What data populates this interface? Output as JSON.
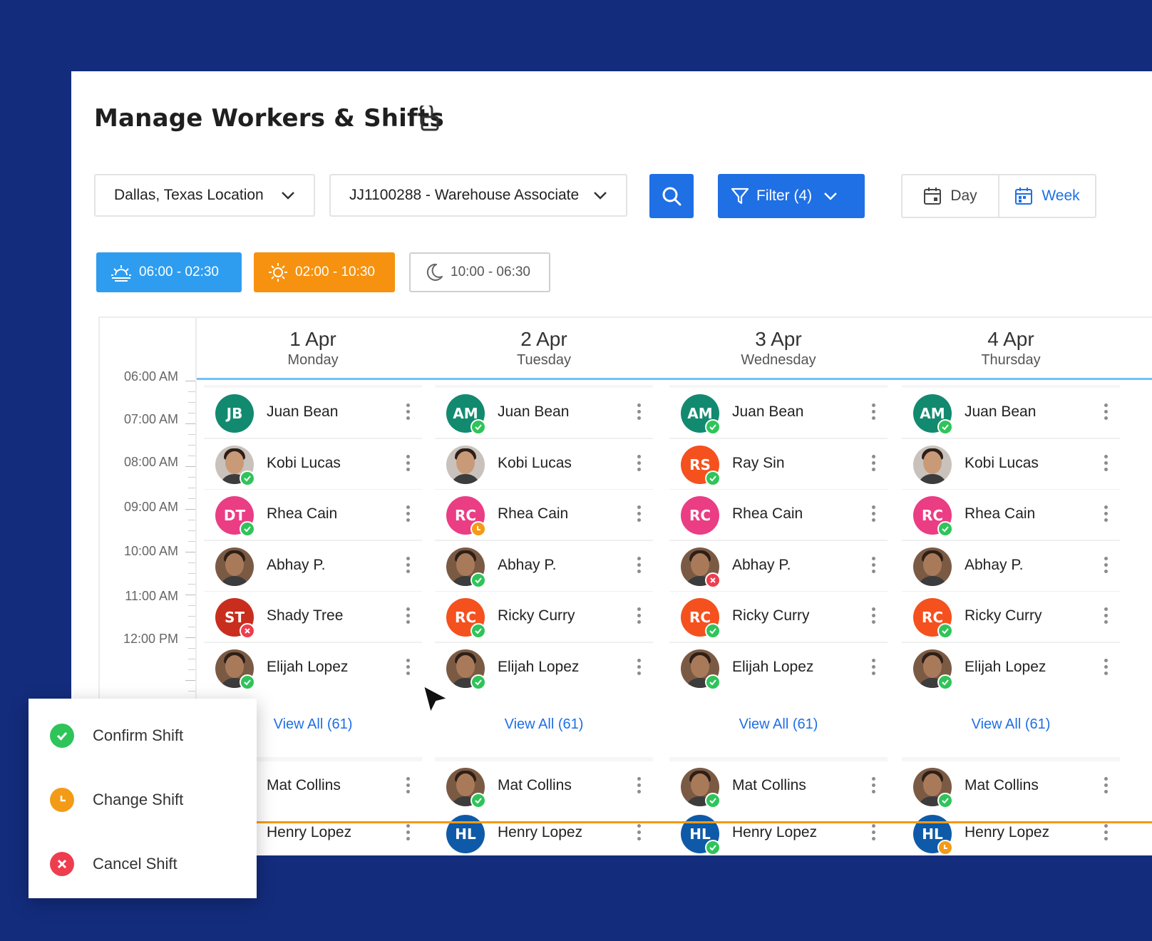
{
  "header": {
    "title": "Manage Workers & Shifts"
  },
  "toolbar": {
    "location": "Dallas, Texas Location",
    "job": "JJ1100288 - Warehouse Associate",
    "filter_label": "Filter (4)",
    "view_day": "Day",
    "view_week": "Week"
  },
  "shifts": [
    {
      "label": "06:00 - 02:30",
      "color": "#2e9df0"
    },
    {
      "label": "02:00 - 10:30",
      "color": "#f6920f"
    },
    {
      "label": "10:00 - 06:30",
      "color": "#ffffff"
    }
  ],
  "times": [
    "06:00 AM",
    "07:00 AM",
    "08:00 AM",
    "09:00 AM",
    "10:00 AM",
    "11:00 AM",
    "12:00 PM"
  ],
  "days": [
    {
      "date": "1 Apr",
      "weekday": "Monday",
      "view_all": "View All (61)",
      "workers": [
        {
          "name": "Juan Bean",
          "initials": "JB",
          "color": "#128a6f",
          "status": "none"
        },
        {
          "name": "Kobi Lucas",
          "initials": "",
          "color": "",
          "status": "ok"
        },
        {
          "name": "Rhea Cain",
          "initials": "DT",
          "color": "#ea3d84",
          "status": "ok"
        },
        {
          "name": "Abhay P.",
          "initials": "",
          "color": "",
          "status": "none"
        },
        {
          "name": "Shady Tree",
          "initials": "ST",
          "color": "#c92d1d",
          "status": "cancel"
        },
        {
          "name": "Elijah Lopez",
          "initials": "",
          "color": "",
          "status": "ok"
        }
      ],
      "below": [
        {
          "name": "Mat Collins"
        },
        {
          "name": "Henry Lopez"
        }
      ]
    },
    {
      "date": "2 Apr",
      "weekday": "Tuesday",
      "view_all": "View All (61)",
      "workers": [
        {
          "name": "Juan Bean",
          "initials": "AM",
          "color": "#128a6f",
          "status": "ok"
        },
        {
          "name": "Kobi Lucas",
          "initials": "",
          "color": "",
          "status": "none"
        },
        {
          "name": "Rhea Cain",
          "initials": "RC",
          "color": "#ea3d84",
          "status": "change"
        },
        {
          "name": "Abhay P.",
          "initials": "",
          "color": "",
          "status": "ok"
        },
        {
          "name": "Ricky Curry",
          "initials": "RC",
          "color": "#f4511e",
          "status": "ok"
        },
        {
          "name": "Elijah Lopez",
          "initials": "",
          "color": "",
          "status": "ok"
        }
      ],
      "below": [
        {
          "name": "Mat Collins",
          "status": "ok"
        },
        {
          "name": "Henry Lopez",
          "initials": "HL",
          "color": "#0f5aa8",
          "status": "none"
        }
      ]
    },
    {
      "date": "3 Apr",
      "weekday": "Wednesday",
      "view_all": "View All (61)",
      "workers": [
        {
          "name": "Juan Bean",
          "initials": "AM",
          "color": "#128a6f",
          "status": "ok"
        },
        {
          "name": "Ray Sin",
          "initials": "RS",
          "color": "#f4511e",
          "status": "ok"
        },
        {
          "name": "Rhea Cain",
          "initials": "RC",
          "color": "#ea3d84",
          "status": "none"
        },
        {
          "name": "Abhay P.",
          "initials": "",
          "color": "",
          "status": "cancel"
        },
        {
          "name": "Ricky Curry",
          "initials": "RC",
          "color": "#f4511e",
          "status": "ok"
        },
        {
          "name": "Elijah Lopez",
          "initials": "",
          "color": "",
          "status": "ok"
        }
      ],
      "below": [
        {
          "name": "Mat Collins",
          "status": "ok"
        },
        {
          "name": "Henry Lopez",
          "initials": "HL",
          "color": "#0f5aa8",
          "status": "ok"
        }
      ]
    },
    {
      "date": "4 Apr",
      "weekday": "Thursday",
      "view_all": "View All (61)",
      "workers": [
        {
          "name": "Juan Bean",
          "initials": "AM",
          "color": "#128a6f",
          "status": "ok"
        },
        {
          "name": "Kobi Lucas",
          "initials": "",
          "color": "",
          "status": "none"
        },
        {
          "name": "Rhea Cain",
          "initials": "RC",
          "color": "#ea3d84",
          "status": "ok"
        },
        {
          "name": "Abhay P.",
          "initials": "",
          "color": "",
          "status": "none"
        },
        {
          "name": "Ricky Curry",
          "initials": "RC",
          "color": "#f4511e",
          "status": "ok"
        },
        {
          "name": "Elijah Lopez",
          "initials": "",
          "color": "",
          "status": "ok"
        }
      ],
      "below": [
        {
          "name": "Mat Collins",
          "status": "ok"
        },
        {
          "name": "Henry Lopez",
          "initials": "HL",
          "color": "#0f5aa8",
          "status": "change"
        }
      ]
    }
  ],
  "context_menu": {
    "confirm": "Confirm Shift",
    "change": "Change Shift",
    "cancel": "Cancel Shift"
  },
  "colors": {
    "primary": "#1f6fe5",
    "confirm": "#2fc45a",
    "change": "#f39a16",
    "cancel": "#ee3d4f",
    "background": "#132c7c"
  }
}
